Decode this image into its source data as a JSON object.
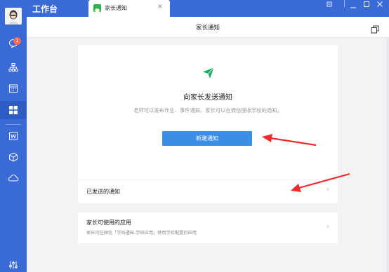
{
  "app": {
    "workspace_title": "工作台",
    "tab_label": "家长通知",
    "tab_close": "×",
    "page_title": "家长通知",
    "badge_count": "1"
  },
  "rail": {
    "icons": [
      "avatar",
      "chat-icon",
      "org-chart-icon",
      "calendar-icon",
      "workbench-grid-icon",
      "word-doc-icon",
      "cube-icon",
      "cloud-icon",
      "settings-sliders-icon"
    ]
  },
  "main_card": {
    "title": "向家长发送通知",
    "description": "老师可以发布作业、事件通知，家长可以在微信接收学校的通知。",
    "button_label": "新建通知",
    "sent_label": "已发送的通知",
    "chevron": "›"
  },
  "apps_card": {
    "title": "家长可使用的应用",
    "description": "家长可在微信「学校通知-学校应用」使用学校配置的应用",
    "chevron": "›"
  },
  "colors": {
    "brand_blue": "#3a6ad6",
    "button_blue": "#3a8ee6",
    "send_green": "#1aad5e",
    "arrow_red": "#ee2c2c"
  }
}
